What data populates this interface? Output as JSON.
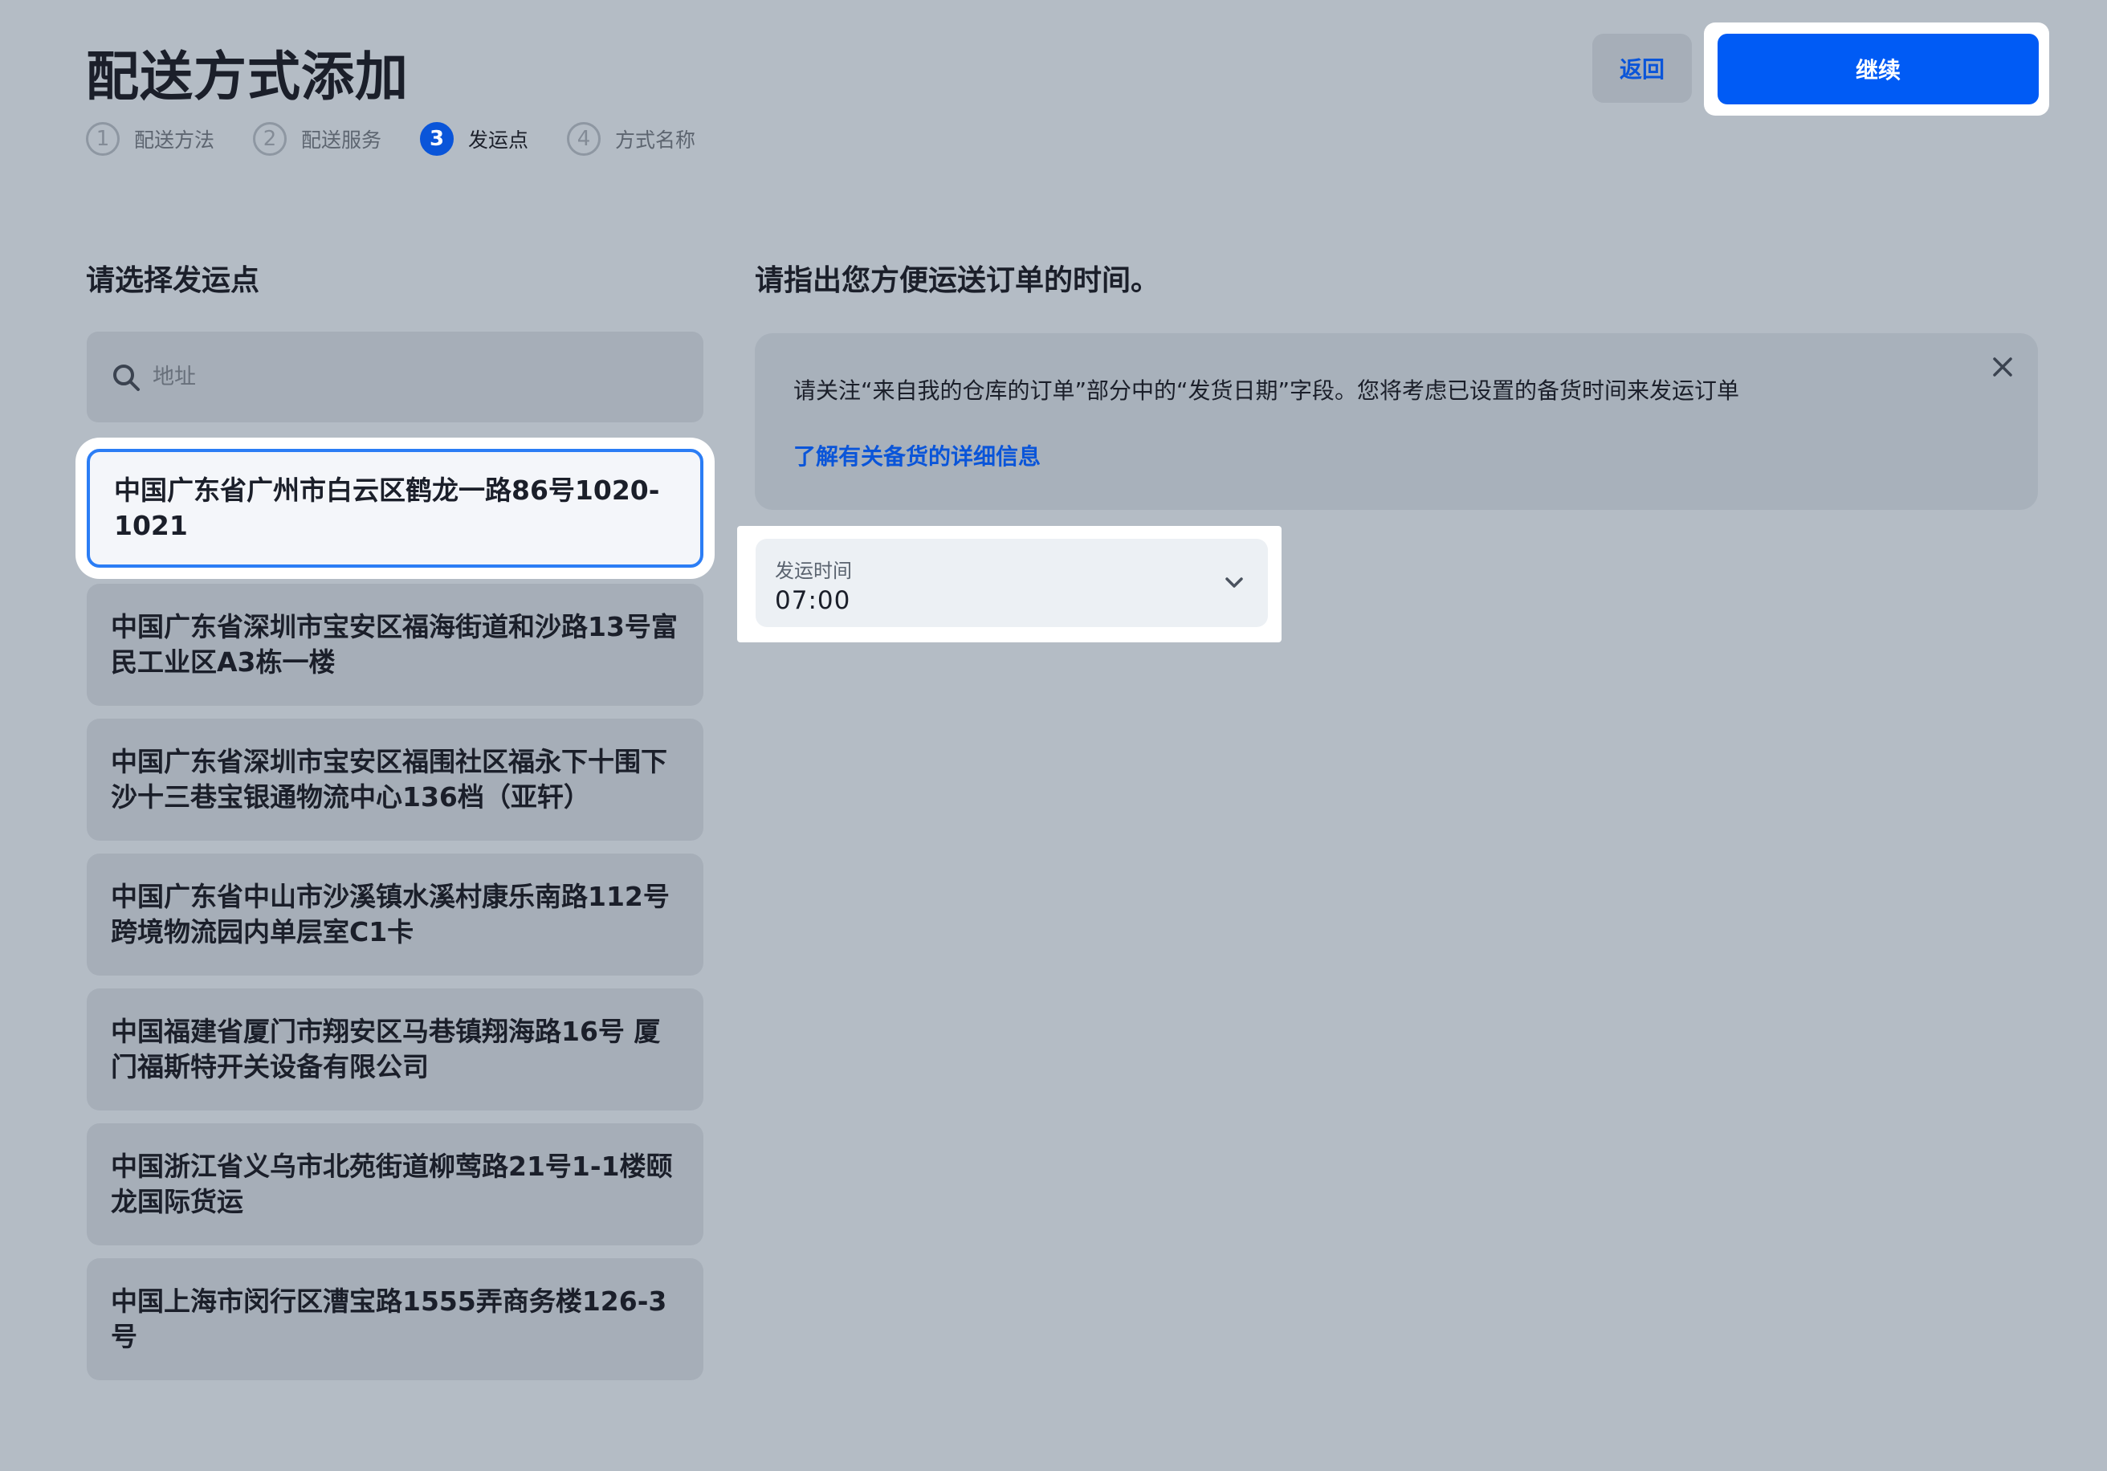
{
  "header": {
    "title": "配送方式添加",
    "back_label": "返回",
    "continue_label": "继续"
  },
  "stepper": [
    {
      "num": "1",
      "label": "配送方法",
      "active": false
    },
    {
      "num": "2",
      "label": "配送服务",
      "active": false
    },
    {
      "num": "3",
      "label": "发运点",
      "active": true
    },
    {
      "num": "4",
      "label": "方式名称",
      "active": false
    }
  ],
  "left": {
    "title": "请选择发运点",
    "search_placeholder": "地址",
    "addresses": [
      {
        "text": "中国广东省广州市白云区鹤龙一路86号1020-1021",
        "selected": true
      },
      {
        "text": "中国广东省深圳市宝安区福海街道和沙路13号富民工业区A3栋一楼",
        "selected": false
      },
      {
        "text": "中国广东省深圳市宝安区福围社区福永下十围下沙十三巷宝银通物流中心136档（亚轩）",
        "selected": false
      },
      {
        "text": "中国广东省中山市沙溪镇水溪村康乐南路112号跨境物流园内单层室C1卡",
        "selected": false
      },
      {
        "text": "中国福建省厦门市翔安区马巷镇翔海路16号 厦门福斯特开关设备有限公司",
        "selected": false
      },
      {
        "text": "中国浙江省义乌市北苑街道柳莺路21号1-1楼颐龙国际货运",
        "selected": false
      },
      {
        "text": "中国上海市闵行区漕宝路1555弄商务楼126-3号",
        "selected": false
      }
    ]
  },
  "right": {
    "title": "请指出您方便运送订单的时间。",
    "info_text": "请关注“来自我的仓库的订单”部分中的“发货日期”字段。您将考虑已设置的备货时间来发运订单",
    "info_link": "了解有关备货的详细信息",
    "time_label": "发运时间",
    "time_value": "07:00"
  },
  "colors": {
    "background": "#b4bcc5",
    "accent": "#005bf5",
    "link": "#0a55d9"
  },
  "icons": [
    "search-icon",
    "close-icon",
    "chevron-down-icon"
  ]
}
